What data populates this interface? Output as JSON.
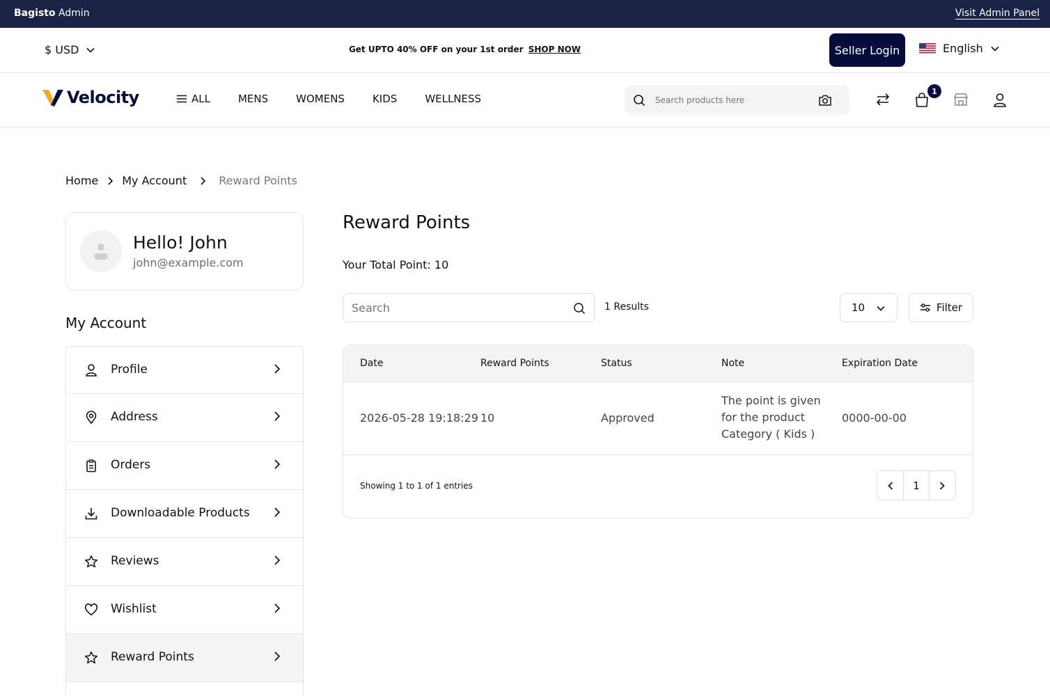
{
  "admin_bar": {
    "brand_bold": "Bagisto",
    "brand_rest": "Admin",
    "link": "Visit Admin Panel"
  },
  "promo_row": {
    "currency": "$ USD",
    "promo_text": "Get UPTO 40% OFF on your 1st order",
    "promo_link": "SHOP NOW",
    "seller_login": "Seller Login",
    "language": "English"
  },
  "header": {
    "logo_text": "Velocity",
    "nav": [
      "ALL",
      "MENS",
      "WOMENS",
      "KIDS",
      "WELLNESS"
    ],
    "search_placeholder": "Search products here",
    "cart_count": "1"
  },
  "breadcrumb": {
    "home": "Home",
    "account": "My Account",
    "current": "Reward Points"
  },
  "profile": {
    "greeting": "Hello! John",
    "email": "john@example.com"
  },
  "sidebar": {
    "title": "My Account",
    "items": [
      {
        "label": "Profile",
        "icon": "user-icon"
      },
      {
        "label": "Address",
        "icon": "location-pin-icon"
      },
      {
        "label": "Orders",
        "icon": "clipboard-icon"
      },
      {
        "label": "Downloadable Products",
        "icon": "download-icon"
      },
      {
        "label": "Reviews",
        "icon": "star-icon"
      },
      {
        "label": "Wishlist",
        "icon": "heart-icon"
      },
      {
        "label": "Reward Points",
        "icon": "star-icon",
        "active": true
      }
    ]
  },
  "content": {
    "title": "Reward Points",
    "total_point": "Your Total Point: 10",
    "search_placeholder": "Search",
    "results": "1 Results",
    "per_page": "10",
    "filter": "Filter",
    "columns": [
      "Date",
      "Reward Points",
      "Status",
      "Note",
      "Expiration Date"
    ],
    "rows": [
      {
        "date": "2026-05-28 19:18:29",
        "points": "10",
        "status": "Approved",
        "note": "The point is given for the product Category ( Kids )",
        "expiration": "0000-00-00"
      }
    ],
    "showing": "Showing 1 to 1 of 1 entries",
    "page": "1"
  },
  "colors": {
    "admin_bar": "#1b2346",
    "primary": "#060c3b",
    "logo_accent": "#f5a623"
  }
}
